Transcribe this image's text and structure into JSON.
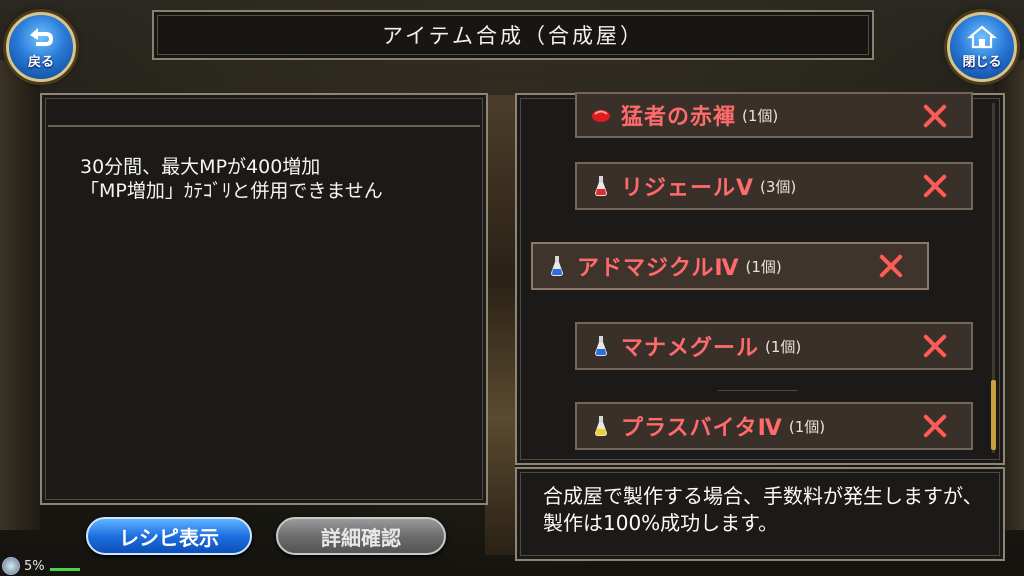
{
  "header": {
    "title": "アイテム合成（合成屋）",
    "back_label": "戻る",
    "close_label": "閉じる"
  },
  "description": {
    "text": "30分間、最大MPが400増加\n「MP増加」ｶﾃｺﾞﾘと併用できません"
  },
  "materials": [
    {
      "name": "猛者の赤褌",
      "count": "(1個)",
      "icon": "red-cloth-icon"
    },
    {
      "name": "リジェールⅤ",
      "count": "(3個)",
      "icon": "red-potion-icon"
    },
    {
      "name": "アドマジクルⅣ",
      "count": "(1個)",
      "icon": "blue-potion-icon"
    },
    {
      "name": "マナメグール",
      "count": "(1個)",
      "icon": "blue-potion-icon"
    },
    {
      "name": "プラスバイタⅣ",
      "count": "(1個)",
      "icon": "yellow-potion-icon"
    }
  ],
  "note": {
    "text": "合成屋で製作する場合、手数料が発生しますが、製作は100%成功します。"
  },
  "buttons": {
    "recipe": "レシピ表示",
    "detail": "詳細確認"
  },
  "status": {
    "battery": "5%"
  },
  "colors": {
    "item_name": "#ff6b6b",
    "remove_x": "#ff5b57",
    "recipe_button": "#1f6fe0",
    "detail_button": "#6d6d6d"
  }
}
